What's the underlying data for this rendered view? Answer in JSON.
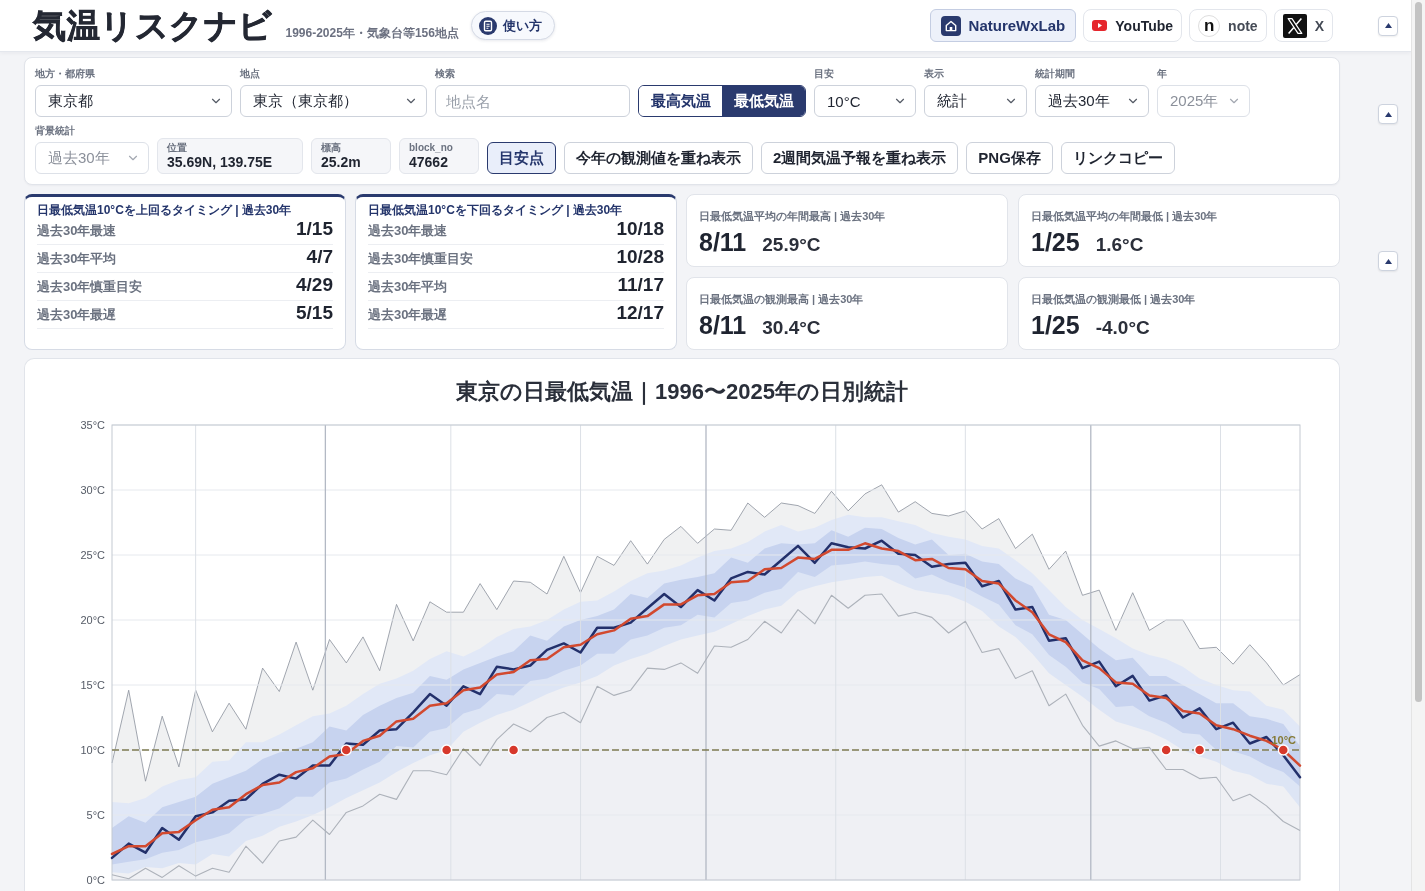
{
  "header": {
    "title": "気温リスクナビ",
    "subtitle": "1996-2025年・気象台等156地点",
    "help_button": "使い方",
    "links": [
      {
        "kind": "lab",
        "label": "NatureWxLab"
      },
      {
        "kind": "youtube",
        "label": "YouTube"
      },
      {
        "kind": "note",
        "label": "note",
        "glyph": "n"
      },
      {
        "kind": "x",
        "label": "X"
      }
    ]
  },
  "filters": [
    {
      "kind": "select",
      "label": "地方・都府県",
      "value": "東京都",
      "disabled": false
    },
    {
      "kind": "select",
      "label": "地点",
      "value": "東京（東京都）",
      "disabled": false
    },
    {
      "kind": "search",
      "label": "検索",
      "placeholder": "地点名"
    },
    {
      "kind": "toggle",
      "options": [
        {
          "label": "最高気温",
          "selected": false
        },
        {
          "label": "最低気温",
          "selected": true
        }
      ]
    },
    {
      "kind": "select",
      "label": "目安",
      "value": "10°C",
      "disabled": false
    },
    {
      "kind": "select",
      "label": "表示",
      "value": "統計",
      "disabled": false
    },
    {
      "kind": "select",
      "label": "統計期間",
      "value": "過去30年",
      "disabled": false
    },
    {
      "kind": "select",
      "label": "年",
      "value": "2025年",
      "disabled": true
    }
  ],
  "tools": {
    "background_select": {
      "label": "背景統計",
      "value": "過去30年",
      "disabled": true
    },
    "info": [
      {
        "label": "位置",
        "value": "35.69N, 139.75E"
      },
      {
        "label": "標高",
        "value": "25.2m"
      },
      {
        "label": "block_no",
        "value": "47662"
      }
    ],
    "buttons": [
      {
        "label": "目安点",
        "selected": true
      },
      {
        "label": "今年の観測値を重ね表示",
        "selected": false
      },
      {
        "label": "2週間気温予報を重ね表示",
        "selected": false
      },
      {
        "label": "PNG保存",
        "selected": false
      },
      {
        "label": "リンクコピー",
        "selected": false
      }
    ]
  },
  "timing_cards": [
    {
      "title": "日最低気温10°Cを上回るタイミング | 過去30年",
      "rows": [
        {
          "label": "過去30年最速",
          "value": "1/15"
        },
        {
          "label": "過去30年平均",
          "value": "4/7"
        },
        {
          "label": "過去30年慎重目安",
          "value": "4/29"
        },
        {
          "label": "過去30年最遅",
          "value": "5/15"
        }
      ]
    },
    {
      "title": "日最低気温10°Cを下回るタイミング | 過去30年",
      "rows": [
        {
          "label": "過去30年最速",
          "value": "10/18"
        },
        {
          "label": "過去30年慎重目安",
          "value": "10/28"
        },
        {
          "label": "過去30年平均",
          "value": "11/17"
        },
        {
          "label": "過去30年最遅",
          "value": "12/17"
        }
      ]
    }
  ],
  "summary_cards": [
    {
      "title": "日最低気温平均の年間最高 | 過去30年",
      "date": "8/11",
      "value": "25.9°C"
    },
    {
      "title": "日最低気温平均の年間最低 | 過去30年",
      "date": "1/25",
      "value": "1.6°C"
    },
    {
      "title": "日最低気温の観測最高 | 過去30年",
      "date": "8/11",
      "value": "30.4°C"
    },
    {
      "title": "日最低気温の観測最低 | 過去30年",
      "date": "1/25",
      "value": "-4.0°C"
    }
  ],
  "chart": {
    "chart_data": {
      "type": "line",
      "title": "東京の日最低気温｜1996〜2025年の日別統計",
      "grid": true,
      "categories": [
        null,
        null,
        null,
        null,
        null,
        null,
        null,
        null,
        null,
        null,
        null,
        null,
        null,
        null,
        null,
        null,
        null,
        null,
        null,
        null,
        null,
        null,
        null,
        null,
        null,
        null,
        null,
        null,
        null,
        null,
        null,
        null,
        null,
        null,
        null,
        null,
        null,
        null,
        null,
        null,
        null,
        null,
        null,
        null,
        null,
        null,
        null,
        null,
        null,
        null,
        null,
        null,
        null,
        null,
        null,
        null,
        null,
        null,
        null,
        null,
        null,
        null,
        null,
        null,
        null,
        null,
        null,
        null,
        null,
        null,
        null,
        null
      ],
      "ylim": [
        0,
        35
      ],
      "yticks": [
        {
          "value": 0,
          "label": "0°C"
        },
        {
          "value": 5,
          "label": "5°C"
        },
        {
          "value": 10,
          "label": "10°C"
        },
        {
          "value": 15,
          "label": "15°C"
        },
        {
          "value": 20,
          "label": "20°C"
        },
        {
          "value": 25,
          "label": "25°C"
        },
        {
          "value": 30,
          "label": "30°C"
        },
        {
          "value": 35,
          "label": "35°C"
        }
      ],
      "series": [
        {
          "type": "area",
          "color": "#8a919c",
          "values": [
            9.0,
            14.6,
            7.6,
            12.6,
            8.7,
            14.6,
            11.4,
            13.6,
            11.6,
            16.3,
            14.5,
            18.3,
            14.6,
            18.5,
            16.7,
            18.7,
            16.1,
            21.2,
            18.4,
            21.4,
            20.6,
            20.6,
            22.8,
            20.8,
            23.0,
            22.9,
            22.0,
            24.9,
            22.1,
            24.9,
            24.2,
            26.1,
            24.3,
            26.2,
            27.2,
            25.9,
            27.0,
            26.9,
            29.0,
            27.9,
            29.0,
            28.8,
            28.2,
            29.9,
            28.4,
            29.7,
            30.4,
            28.3,
            29.1,
            28.2,
            28.0,
            28.4,
            27.0,
            27.8,
            25.5,
            26.6,
            23.9,
            25.3,
            21.9,
            22.3,
            19.2,
            22.1,
            19.2,
            20.0,
            20.0,
            17.8,
            17.9,
            16.6,
            18.1,
            16.7,
            15.0,
            15.8
          ]
        },
        {
          "type": "area",
          "color": "#e1e8f7",
          "values": [
            6.0,
            5.9,
            6.3,
            7.2,
            7.7,
            7.9,
            9.1,
            9.2,
            10.6,
            10.6,
            11.2,
            11.9,
            12.6,
            12.8,
            13.4,
            14.3,
            15.1,
            15.5,
            16.1,
            17.0,
            17.6,
            17.2,
            17.8,
            18.7,
            19.3,
            19.5,
            20.0,
            20.8,
            21.4,
            21.5,
            22.2,
            23.0,
            23.6,
            23.8,
            24.2,
            24.8,
            25.3,
            25.5,
            26.0,
            26.8,
            27.3,
            26.8,
            27.1,
            27.7,
            28.1,
            27.9,
            27.9,
            27.6,
            27.3,
            26.7,
            26.4,
            26.2,
            25.7,
            25.5,
            24.6,
            23.6,
            22.3,
            21.0,
            20.0,
            19.3,
            18.6,
            17.8,
            17.3,
            17.0,
            16.4,
            15.5,
            15.0,
            14.6,
            14.5,
            13.4,
            13.1,
            11.8
          ]
        },
        {
          "type": "area",
          "color": "#c7d3ef",
          "values": [
            4.0,
            4.9,
            4.4,
            5.6,
            6.0,
            6.4,
            7.4,
            7.9,
            8.4,
            9.3,
            9.8,
            10.1,
            10.6,
            11.8,
            11.5,
            12.7,
            13.4,
            14.0,
            14.4,
            15.7,
            15.4,
            16.2,
            16.7,
            17.2,
            17.6,
            18.8,
            18.4,
            19.5,
            20.0,
            20.3,
            20.8,
            22.0,
            21.7,
            22.8,
            23.1,
            23.3,
            23.6,
            24.8,
            24.4,
            25.5,
            25.9,
            25.8,
            25.9,
            26.9,
            26.4,
            27.1,
            27.0,
            26.3,
            25.8,
            26.2,
            25.0,
            25.1,
            24.5,
            24.3,
            23.2,
            22.6,
            20.4,
            20.0,
            18.9,
            17.8,
            16.9,
            17.1,
            15.7,
            15.7,
            15.0,
            14.3,
            13.6,
            13.6,
            12.6,
            12.4,
            12.0,
            10.3
          ]
        },
        {
          "type": "area",
          "color": "#dde5f5",
          "values": [
            1.2,
            1.4,
            1.6,
            2.1,
            2.3,
            2.9,
            3.2,
            3.6,
            4.7,
            5.1,
            5.5,
            6.4,
            6.4,
            7.5,
            7.8,
            8.5,
            9.1,
            10.3,
            10.2,
            11.4,
            11.7,
            12.8,
            13.2,
            14.3,
            14.2,
            15.3,
            15.5,
            16.1,
            16.5,
            17.4,
            17.4,
            18.5,
            18.8,
            19.4,
            19.6,
            20.4,
            20.2,
            21.3,
            21.5,
            22.1,
            22.4,
            23.7,
            23.3,
            24.2,
            24.3,
            24.5,
            24.3,
            24.2,
            23.2,
            23.5,
            22.9,
            22.5,
            21.8,
            21.2,
            19.6,
            18.9,
            17.3,
            16.4,
            15.2,
            14.7,
            13.3,
            13.4,
            12.6,
            12.1,
            11.3,
            11.2,
            10.0,
            9.9,
            9.5,
            8.8,
            8.3,
            7.2
          ]
        },
        {
          "type": "area",
          "color": "#eff0f4",
          "values": [
            0.6,
            0.5,
            1.0,
            0.9,
            1.3,
            1.2,
            2.0,
            1.8,
            3.0,
            3.4,
            4.1,
            4.5,
            5.0,
            5.6,
            6.3,
            6.9,
            7.5,
            8.3,
            9.0,
            9.6,
            10.0,
            11.4,
            12.1,
            12.7,
            13.1,
            13.7,
            14.3,
            14.8,
            15.2,
            15.7,
            16.5,
            17.0,
            17.4,
            18.0,
            18.5,
            18.8,
            19.1,
            19.7,
            20.3,
            20.8,
            21.1,
            22.2,
            22.6,
            22.9,
            23.1,
            23.3,
            23.4,
            22.8,
            22.3,
            22.1,
            21.9,
            21.4,
            20.7,
            19.5,
            18.7,
            17.4,
            15.9,
            15.0,
            14.1,
            13.1,
            12.2,
            11.8,
            11.4,
            10.8,
            10.0,
            9.5,
            9.1,
            8.4,
            8.1,
            7.4,
            7.2,
            5.6
          ]
        },
        {
          "type": "line",
          "color": "#adb2ba",
          "values": [
            0.4,
            0.1,
            0.9,
            0.2,
            1.1,
            0.3,
            0.9,
            0.6,
            2.6,
            1.3,
            3.0,
            3.3,
            4.6,
            3.5,
            5.2,
            5.7,
            6.6,
            6.2,
            8.4,
            8.4,
            8.1,
            10.1,
            8.8,
            10.8,
            12.0,
            11.4,
            12.5,
            12.9,
            12.1,
            14.9,
            14.2,
            14.6,
            16.3,
            16.2,
            16.7,
            15.9,
            18.0,
            17.9,
            18.5,
            19.9,
            19.0,
            20.8,
            19.7,
            21.9,
            20.9,
            21.9,
            22.0,
            20.3,
            20.6,
            20.2,
            19.0,
            19.9,
            17.5,
            17.8,
            15.5,
            16.1,
            13.4,
            14.3,
            11.9,
            10.3,
            10.7,
            10.1,
            10.2,
            8.5,
            8.5,
            7.8,
            7.9,
            6.1,
            6.6,
            5.7,
            4.5,
            3.8
          ]
        },
        {
          "type": "line",
          "color": "#23306b",
          "values": [
            1.7,
            2.8,
            2.1,
            4.0,
            3.1,
            4.9,
            5.2,
            6.1,
            6.2,
            7.4,
            8.1,
            7.8,
            8.8,
            8.8,
            10.5,
            10.4,
            11.5,
            11.6,
            12.9,
            14.3,
            13.4,
            14.9,
            14.3,
            16.4,
            16.2,
            16.5,
            17.7,
            18.2,
            17.5,
            19.4,
            19.4,
            19.8,
            20.9,
            22.0,
            21.0,
            22.3,
            21.5,
            23.2,
            23.7,
            23.5,
            24.6,
            25.7,
            24.4,
            25.9,
            25.6,
            25.5,
            26.1,
            25.1,
            25.0,
            24.1,
            24.3,
            24.4,
            22.6,
            23.0,
            20.8,
            21.0,
            18.4,
            18.6,
            16.3,
            16.8,
            14.9,
            15.7,
            13.8,
            14.2,
            12.5,
            13.2,
            11.6,
            12.1,
            10.5,
            11.0,
            9.6,
            7.9
          ]
        },
        {
          "type": "line",
          "color": "#d2492f",
          "values": [
            2.0,
            2.6,
            2.6,
            3.6,
            3.7,
            4.6,
            5.4,
            5.6,
            6.6,
            7.3,
            7.5,
            8.3,
            8.6,
            9.5,
            9.7,
            10.7,
            11.1,
            12.2,
            12.4,
            13.4,
            13.6,
            14.6,
            14.8,
            15.8,
            16.0,
            16.9,
            17.0,
            17.9,
            18.1,
            18.9,
            19.2,
            20.1,
            20.3,
            21.2,
            21.2,
            21.9,
            22.0,
            22.9,
            23.0,
            23.9,
            24.0,
            24.8,
            24.7,
            25.4,
            25.4,
            25.9,
            25.5,
            25.3,
            24.6,
            24.7,
            24.0,
            23.9,
            23.0,
            22.8,
            21.5,
            20.6,
            18.9,
            18.3,
            16.9,
            16.3,
            15.2,
            15.1,
            14.2,
            14.0,
            13.0,
            12.8,
            11.9,
            11.6,
            11.1,
            10.7,
            10.0,
            8.8
          ]
        },
        {
          "type": "scatter",
          "color": "#d7382b",
          "values": [
            null,
            null,
            null,
            null,
            null,
            null,
            null,
            null,
            null,
            null,
            null,
            null,
            null,
            null,
            10,
            null,
            null,
            null,
            null,
            null,
            10,
            null,
            null,
            null,
            10,
            null,
            null,
            null,
            null,
            null,
            null,
            null,
            null,
            null,
            null,
            null,
            null,
            null,
            null,
            null,
            null,
            null,
            null,
            null,
            null,
            null,
            null,
            null,
            null,
            null,
            null,
            null,
            null,
            null,
            null,
            null,
            null,
            null,
            null,
            null,
            null,
            null,
            null,
            10,
            null,
            10,
            null,
            null,
            null,
            null,
            10,
            null
          ]
        }
      ],
      "ref_lines": [
        {
          "axis": "y",
          "value": 10,
          "label": "10°C"
        }
      ]
    }
  }
}
